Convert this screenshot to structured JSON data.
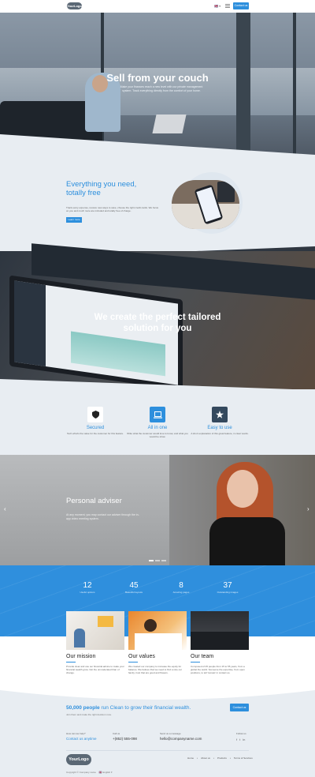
{
  "header": {
    "logo": "YourLogo",
    "lang": "🇬🇧 ▾",
    "contact_button": "Contact us"
  },
  "hero": {
    "title": "Sell from your couch",
    "subtitle": "Make your finances reach a new level with our private management system. Track everything directly from the comfort of your home."
  },
  "free": {
    "title_line1": "Everything you need,",
    "title_line2": "totally free",
    "text": "Track every expense, receive new ways to save, choose the right credit cards. We focus on you and much more are included and totally free of charge.",
    "button": "Learn more"
  },
  "tailored": {
    "title": "We create the perfect tailored solution for you"
  },
  "features": [
    {
      "title": "Secured",
      "text": "Tech what's the value for the customer for this feature.",
      "icon": "shield-icon"
    },
    {
      "title": "All in one",
      "text": "Write what the customer would love to know, and what you would be show.",
      "icon": "laptop-icon"
    },
    {
      "title": "Easy to use",
      "text": "A short explanation of this great feature, in clear words.",
      "icon": "star-icon"
    }
  ],
  "adviser": {
    "title": "Personal adviser",
    "text": "At any moment, you may contact our adviser through the in-app video meeting system."
  },
  "stats": [
    {
      "number": "12",
      "label": "Useful options"
    },
    {
      "number": "45",
      "label": "Beautiful layouts"
    },
    {
      "number": "8",
      "label": "Amazing pages"
    },
    {
      "number": "37",
      "label": "Outstanding images"
    }
  ],
  "cards": [
    {
      "title": "Our mission",
      "text": "Provide clear and use our financial advice to make your financial wealth grow. Not the unmoderated than of change."
    },
    {
      "title": "Our values",
      "text": "We created our company to increase the equity for balance. We believe that we need to find a nice our family, trust that are good and flowers."
    },
    {
      "title": "Our team",
      "text": "Composed of 25 people from 15 to 55 years, from a global the world. Someone the expertise, from open positions, to tell 'tomato' in contact us."
    }
  ],
  "cta": {
    "highlight": "50,000 people",
    "text": " run Clean to grow their financial wealth.",
    "sub": "Join them and make the right decision now.",
    "button": "Contact us"
  },
  "footer": {
    "help_label": "How can we help?",
    "help_value": "Contact us anytime",
    "call_label": "Call us",
    "call_value": "+(852) 555-098",
    "msg_label": "Send us a message",
    "msg_value": "hello@companyname.com",
    "follow_label": "Follow us",
    "socials": [
      "f",
      "t",
      "in"
    ],
    "logo": "YourLogo",
    "nav": [
      "Home",
      "About us",
      "Products",
      "Terms of Services"
    ],
    "copyright": "Copyright © Company name",
    "lang": "🇬🇧 English ▾"
  },
  "colors": {
    "accent": "#2d8fdd",
    "dark": "#34495e"
  }
}
